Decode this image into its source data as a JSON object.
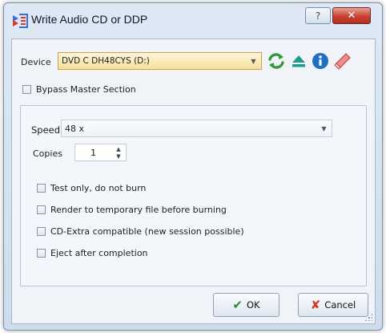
{
  "window": {
    "title": "Write Audio CD or DDP",
    "help_glyph": "?",
    "close_glyph": "✕"
  },
  "device": {
    "label": "Device",
    "value": "DVD C  DH48CYS (D:)",
    "toolbar_icons": [
      "refresh-icon",
      "eject-icon",
      "info-icon",
      "eraser-icon"
    ]
  },
  "bypass_master": {
    "label": "Bypass Master Section",
    "checked": false
  },
  "settings": {
    "speed_label": "Speed",
    "speed_value": "48 x",
    "copies_label": "Copies",
    "copies_value": "1"
  },
  "options": [
    {
      "label": "Test only, do not burn",
      "checked": false
    },
    {
      "label": "Render to temporary file before burning",
      "checked": false
    },
    {
      "label": "CD-Extra compatible (new session possible)",
      "checked": false
    },
    {
      "label": "Eject after completion",
      "checked": false
    }
  ],
  "buttons": {
    "ok_label": "OK",
    "cancel_label": "Cancel"
  },
  "colors": {
    "ok_check": "#2e8b2e",
    "cancel_x": "#d23a1e",
    "device_field": "#f6e29a"
  }
}
